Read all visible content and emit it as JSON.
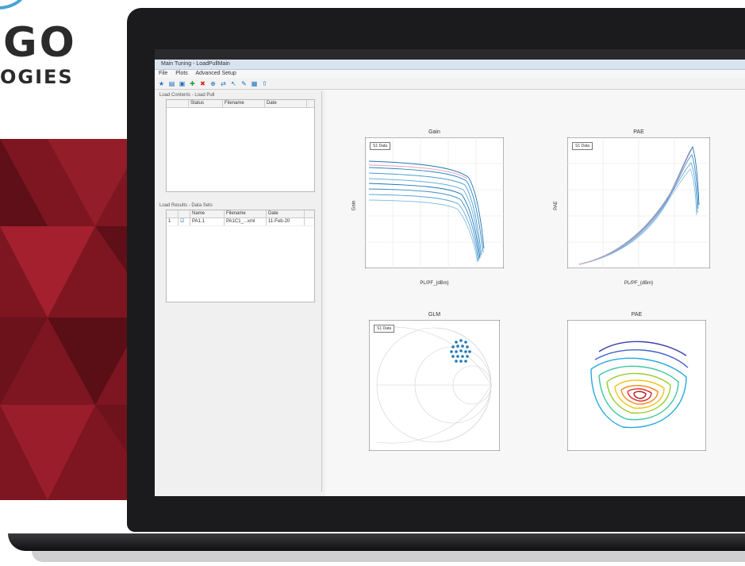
{
  "brand": {
    "word": "GO",
    "subtitle": "OGIES"
  },
  "app": {
    "title": "Main Tuning - LoadPullMain",
    "menu": [
      "File",
      "Plots",
      "Advanced Setup"
    ],
    "left_panel": {
      "group1_label": "Load Contents - Load Pull",
      "group1_columns": [
        "",
        "Status",
        "Filename",
        "Date"
      ],
      "group2_label": "Load Results - Data Sets",
      "group2_columns": [
        "",
        "",
        "Name",
        "Filename",
        "Date"
      ],
      "group2_rows": [
        [
          "1",
          "☑",
          "PA1.1",
          "PA1C1_...xml",
          "11-Feb-20"
        ]
      ]
    },
    "plots": [
      {
        "title": "Gain",
        "xlabel": "PL/PF_{dBm}",
        "ylabel": "Gain",
        "legend": "S1 Data"
      },
      {
        "title": "PAE",
        "xlabel": "PL/PF_{dBm}",
        "ylabel": "PAE",
        "legend": "S1 Data"
      },
      {
        "title": "GLM",
        "legend": "S1 Data"
      },
      {
        "title": "PAE"
      }
    ]
  },
  "colors": {
    "accent": "#1f77b4",
    "brand_red": "#8c1c26",
    "bezel": "#1b1b1e"
  }
}
